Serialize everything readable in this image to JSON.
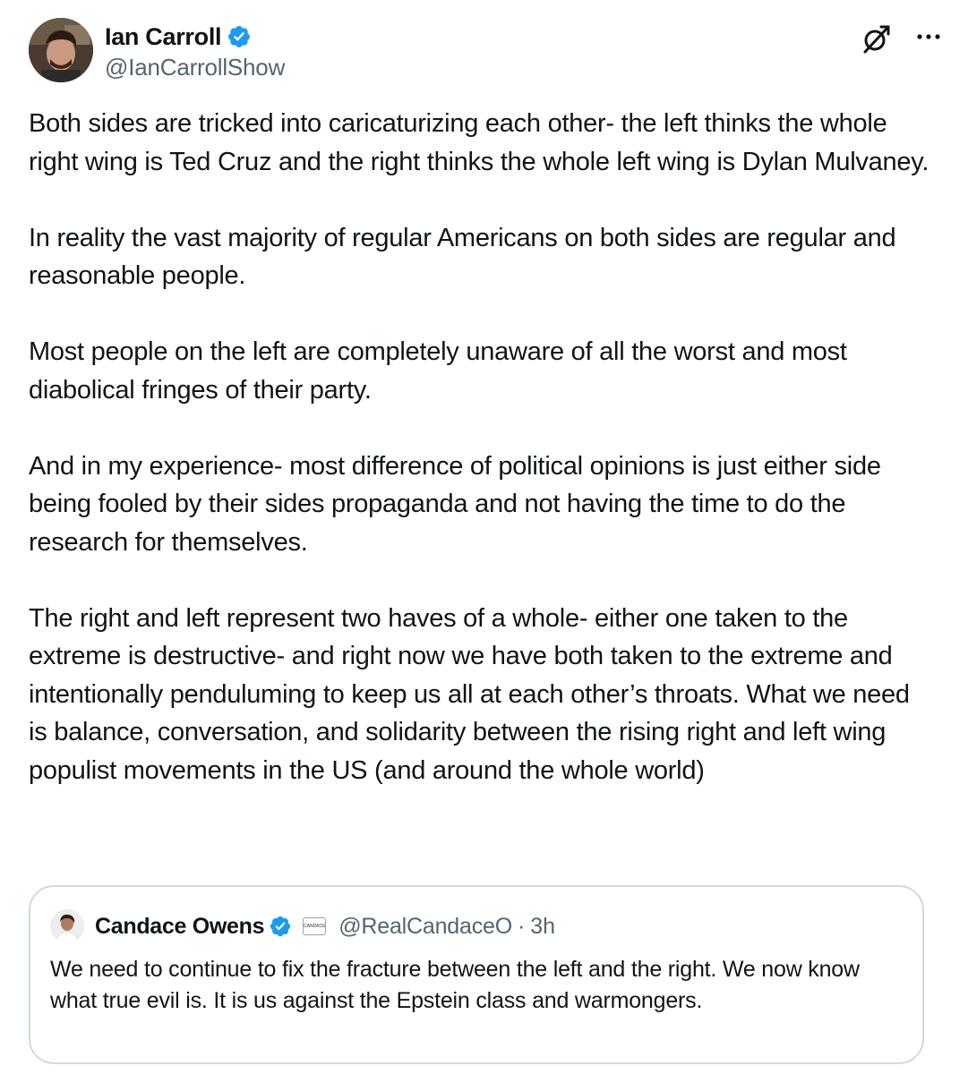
{
  "tweet": {
    "author": {
      "display_name": "Ian Carroll",
      "handle": "@IanCarrollShow",
      "verified": true
    },
    "paragraphs": [
      "Both sides are tricked into caricaturizing each other- the left thinks the whole right wing is Ted Cruz and the right thinks the whole left wing is Dylan Mulvaney.",
      "In reality the vast majority of regular Americans on both sides are regular and reasonable people.",
      "Most people on the left are completely unaware of all the worst and most diabolical fringes of their party.",
      "And in my experience- most difference of political opinions is just either side being fooled by their sides propaganda and not having the time to do the research for themselves.",
      "The right and left represent two haves of a whole- either one taken to the extreme is destructive- and right now we have both taken to the extreme and intentionally penduluming to keep us all at each other’s throats. What we need is balance, conversation, and solidarity between the rising right and left wing populist movements in the US (and around the whole world)"
    ],
    "icons": {
      "verified": "verified-badge-icon",
      "grok": "grok-icon",
      "more": "more-options-icon"
    },
    "colors": {
      "verified_blue": "#1d9bf0",
      "secondary_text": "#536471",
      "border": "#cfd9de"
    }
  },
  "quoted_tweet": {
    "display_name": "Candace Owens",
    "verified": true,
    "affiliation_badge": "CANDACE",
    "handle": "@RealCandaceO",
    "separator": "·",
    "time": "3h",
    "text": "We need to continue to fix the fracture between the left and the right. We now know what true evil is. It is us against the Epstein class and warmongers."
  }
}
